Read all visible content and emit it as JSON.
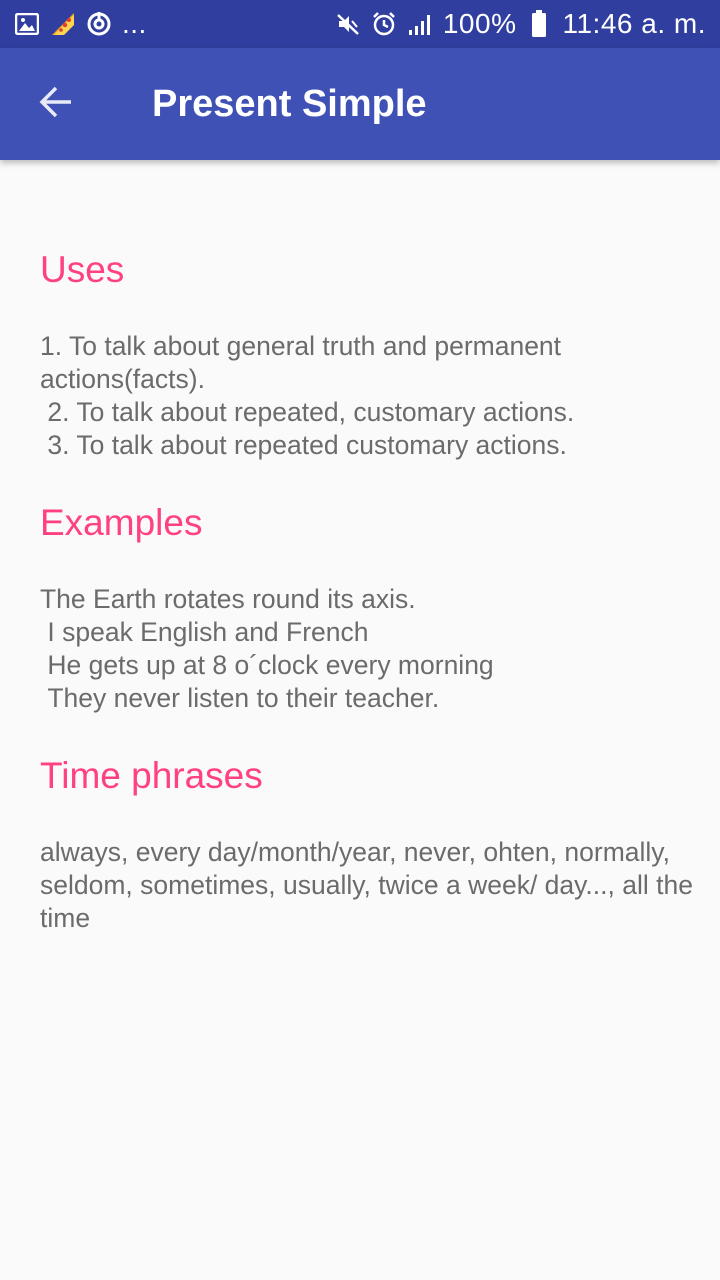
{
  "status_bar": {
    "left_icons": [
      "image-icon",
      "pizza-icon",
      "sync-icon"
    ],
    "more_indicator": "...",
    "right_icons": [
      "mute-icon",
      "alarm-icon",
      "signal-icon"
    ],
    "battery": "100%",
    "time": "11:46 a. m."
  },
  "app_bar": {
    "title": "Present Simple",
    "back_icon": "arrow-back-icon"
  },
  "colors": {
    "status_bar": "#303f9f",
    "app_bar": "#3f51b5",
    "heading": "#ff4081",
    "body_text": "#6b6b6b",
    "background": "#fafafa"
  },
  "sections": {
    "uses": {
      "heading": "Uses",
      "body": "1. To talk about general truth and permanent actions(facts).\n 2. To talk about repeated, customary actions.\n 3. To talk about repeated customary actions."
    },
    "examples": {
      "heading": "Examples",
      "body": "The Earth rotates round its axis.\n I speak English and French\n He gets up at 8 o´clock every morning\n They never listen to their teacher."
    },
    "time_phrases": {
      "heading": "Time phrases",
      "body": "always, every day/month/year, never, ohten, normally, seldom, sometimes, usually, twice a week/ day..., all the time"
    }
  }
}
